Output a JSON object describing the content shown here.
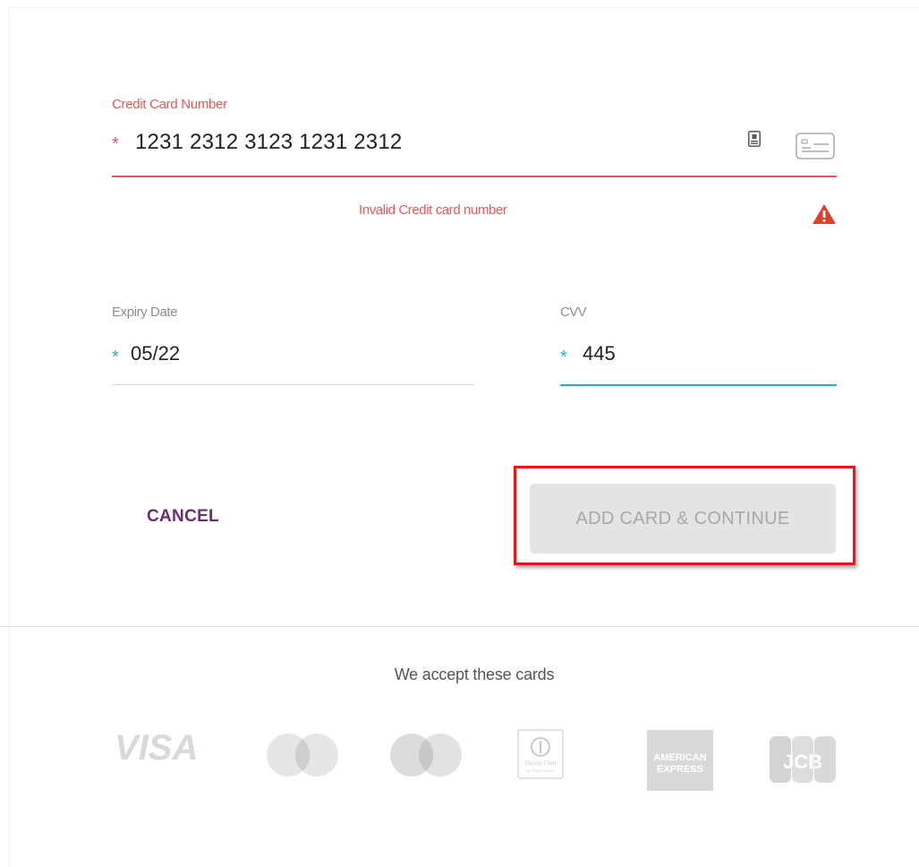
{
  "card_form": {
    "card_number": {
      "label": "Credit Card Number",
      "required_marker": "*",
      "value": "1231 2312 3123 1231 2312",
      "error": "Invalid Credit card number"
    },
    "expiry": {
      "label": "Expiry Date",
      "required_marker": "*",
      "value": "05/22"
    },
    "cvv": {
      "label": "CVV",
      "required_marker": "*",
      "value": "445"
    },
    "buttons": {
      "cancel": "CANCEL",
      "add": "ADD CARD & CONTINUE"
    }
  },
  "accepted_cards": {
    "heading": "We accept these cards",
    "logos": [
      "visa-logo",
      "mastercard-logo",
      "maestro-logo",
      "diners-club-logo",
      "american-express-logo",
      "jcb-logo"
    ],
    "visa_text": "VISA",
    "diners_text": "Diners Club",
    "diners_subtext": "INTERNATIONAL",
    "amex_line1": "AMERICAN",
    "amex_line2": "EXPRESS",
    "jcb_text": "JCB"
  },
  "colors": {
    "error": "#e8575a",
    "focus": "#2bb4b8",
    "cancel_text": "#6b2d6f",
    "highlight": "#e6161c"
  },
  "icons": [
    "card-chip-icon",
    "card-front-icon",
    "warning-icon"
  ]
}
